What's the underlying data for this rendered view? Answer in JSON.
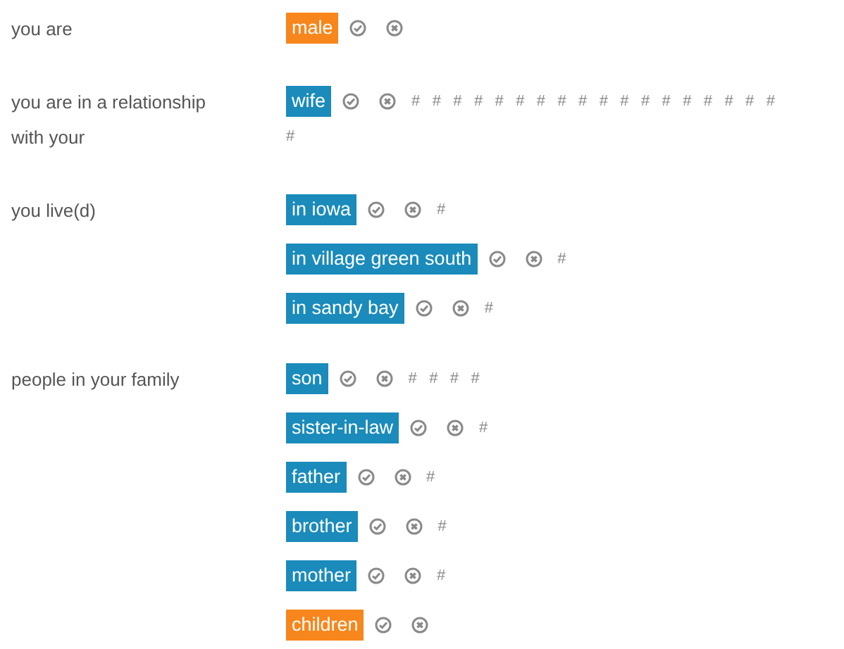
{
  "groups": [
    {
      "label": "you are",
      "entries": [
        {
          "tag": "male",
          "color": "#f7861c"
        }
      ]
    },
    {
      "label": "you are in a relationship with your",
      "entries": [
        {
          "tag": "wife",
          "color": "#1a8bbb",
          "hashes": [
            "#",
            "#",
            "#",
            "#",
            "#",
            "#",
            "#",
            "#",
            "#",
            "#",
            "#",
            "#",
            "#",
            "#",
            "#",
            "#",
            "#",
            "#",
            "#"
          ]
        }
      ]
    },
    {
      "label": "you live(d)",
      "entries": [
        {
          "tag": "in iowa",
          "color": "#1a8bbb",
          "hashes": [
            "#"
          ]
        },
        {
          "tag": "in village green south",
          "color": "#1a8bbb",
          "hashes": [
            "#"
          ]
        },
        {
          "tag": "in sandy bay",
          "color": "#1a8bbb",
          "hashes": [
            "#"
          ]
        }
      ]
    },
    {
      "label": "people in your family",
      "entries": [
        {
          "tag": "son",
          "color": "#1a8bbb",
          "hashes": [
            "#",
            "#",
            "#",
            "#"
          ]
        },
        {
          "tag": "sister-in-law",
          "color": "#1a8bbb",
          "hashes": [
            "#"
          ]
        },
        {
          "tag": "father",
          "color": "#1a8bbb",
          "hashes": [
            "#"
          ]
        },
        {
          "tag": "brother",
          "color": "#1a8bbb",
          "hashes": [
            "#"
          ]
        },
        {
          "tag": "mother",
          "color": "#1a8bbb",
          "hashes": [
            "#"
          ]
        },
        {
          "tag": "children",
          "color": "#f7861c"
        }
      ]
    }
  ]
}
